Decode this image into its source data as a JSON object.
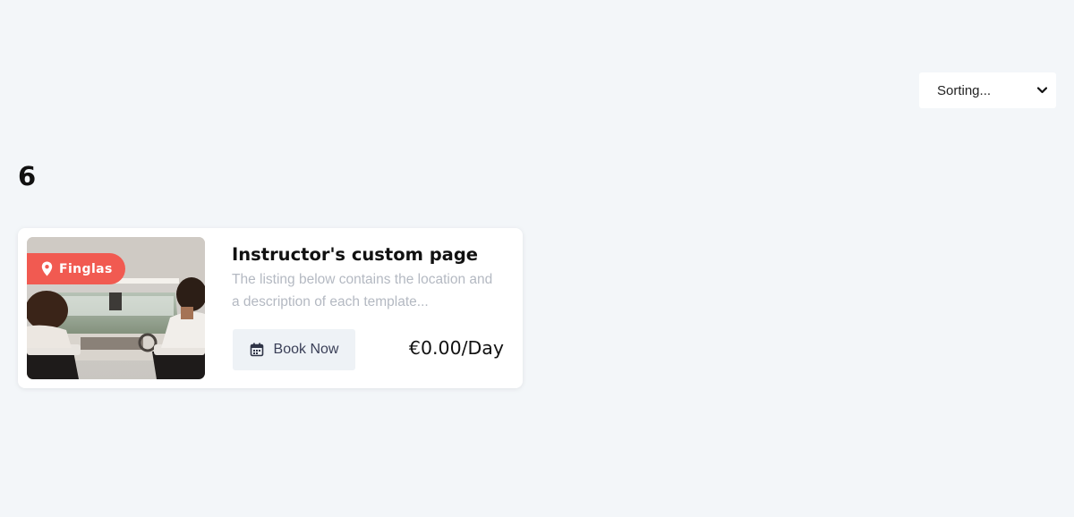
{
  "sorting": {
    "selected": "Sorting...",
    "icon": "chevron-down-icon"
  },
  "results": {
    "count": "6"
  },
  "listing": {
    "location": "Finglas",
    "location_icon": "map-pin-icon",
    "title": "Instructor's custom page",
    "description": "The listing below contains the location and a description of each template...",
    "book_label": "Book Now",
    "book_icon": "calendar-icon",
    "price": "€0.00/Day"
  },
  "colors": {
    "background": "#f3f6f9",
    "badge": "#f15a51",
    "button_bg": "#eef2f6",
    "description_text": "#b4b9c2"
  }
}
